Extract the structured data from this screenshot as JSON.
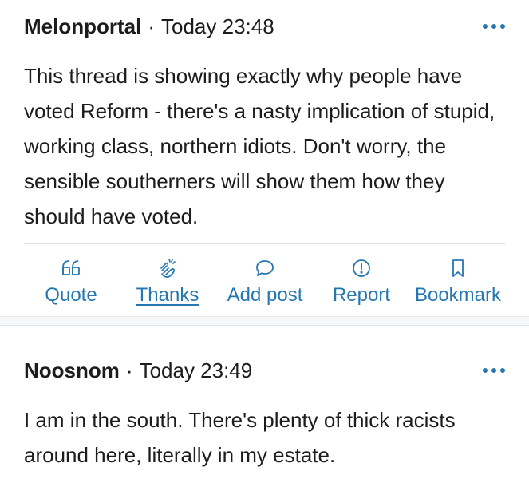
{
  "colors": {
    "accent": "#2577b1",
    "text": "#1c1c1c",
    "divider": "#dfe3e8",
    "gap_background": "#f5f7f9"
  },
  "posts": [
    {
      "author": "Melonportal",
      "separator": "·",
      "timestamp": "Today 23:48",
      "body": "This thread is showing exactly why people have voted Reform - there's a nasty implication of stupid, working class, northern idiots. Don't worry, the sensible southerners will show them how they should have voted.",
      "more_icon": "ellipsis-icon",
      "actions": [
        {
          "label": "Quote",
          "icon": "quote-icon",
          "active": false
        },
        {
          "label": "Thanks",
          "icon": "clapping-hands-icon",
          "active": true
        },
        {
          "label": "Add post",
          "icon": "speech-bubble-icon",
          "active": false
        },
        {
          "label": "Report",
          "icon": "exclamation-circle-icon",
          "active": false
        },
        {
          "label": "Bookmark",
          "icon": "bookmark-icon",
          "active": false
        }
      ]
    },
    {
      "author": "Noosnom",
      "separator": "·",
      "timestamp": "Today 23:49",
      "body": "I am in the south. There's plenty of thick racists around here, literally in my estate.",
      "more_icon": "ellipsis-icon"
    }
  ]
}
